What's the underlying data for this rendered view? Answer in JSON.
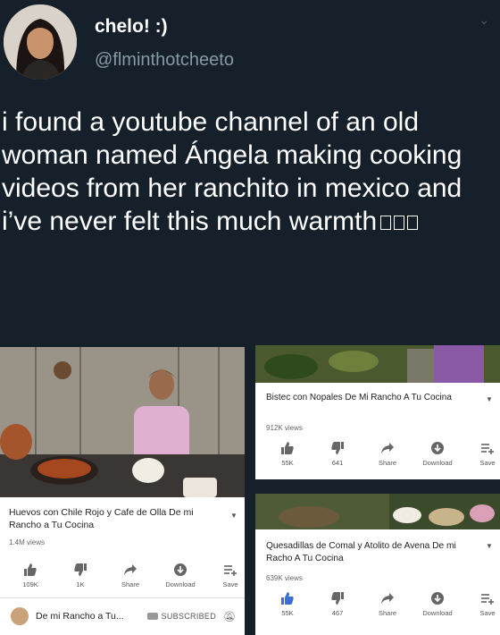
{
  "tweet": {
    "display_name": "chelo! :)",
    "handle": "@flminthotcheeto",
    "text": "i found a youtube channel of an old woman named Ángela making cooking videos from her ranchito in mexico and i’ve never felt this much warmth"
  },
  "videos": [
    {
      "title": "Huevos con Chile Rojo y Cafe de Olla De mi Rancho a Tu Cocina",
      "views": "1.4M views",
      "likes": "109K",
      "dislikes": "1K",
      "share": "Share",
      "download": "Download",
      "save": "Save",
      "channel_name": "De mi Rancho a Tu...",
      "subscribed": "SUBSCRIBED"
    },
    {
      "title": "Bistec con Nopales De Mi Rancho A Tu Cocina",
      "views": "912K views",
      "likes": "55K",
      "dislikes": "641",
      "share": "Share",
      "download": "Download",
      "save": "Save"
    },
    {
      "title": "Quesadillas de Comal y Atolito de Avena De mi Racho A Tu Cocina",
      "views": "639K views",
      "likes": "55K",
      "dislikes": "467",
      "share": "Share",
      "download": "Download",
      "save": "Save"
    }
  ]
}
